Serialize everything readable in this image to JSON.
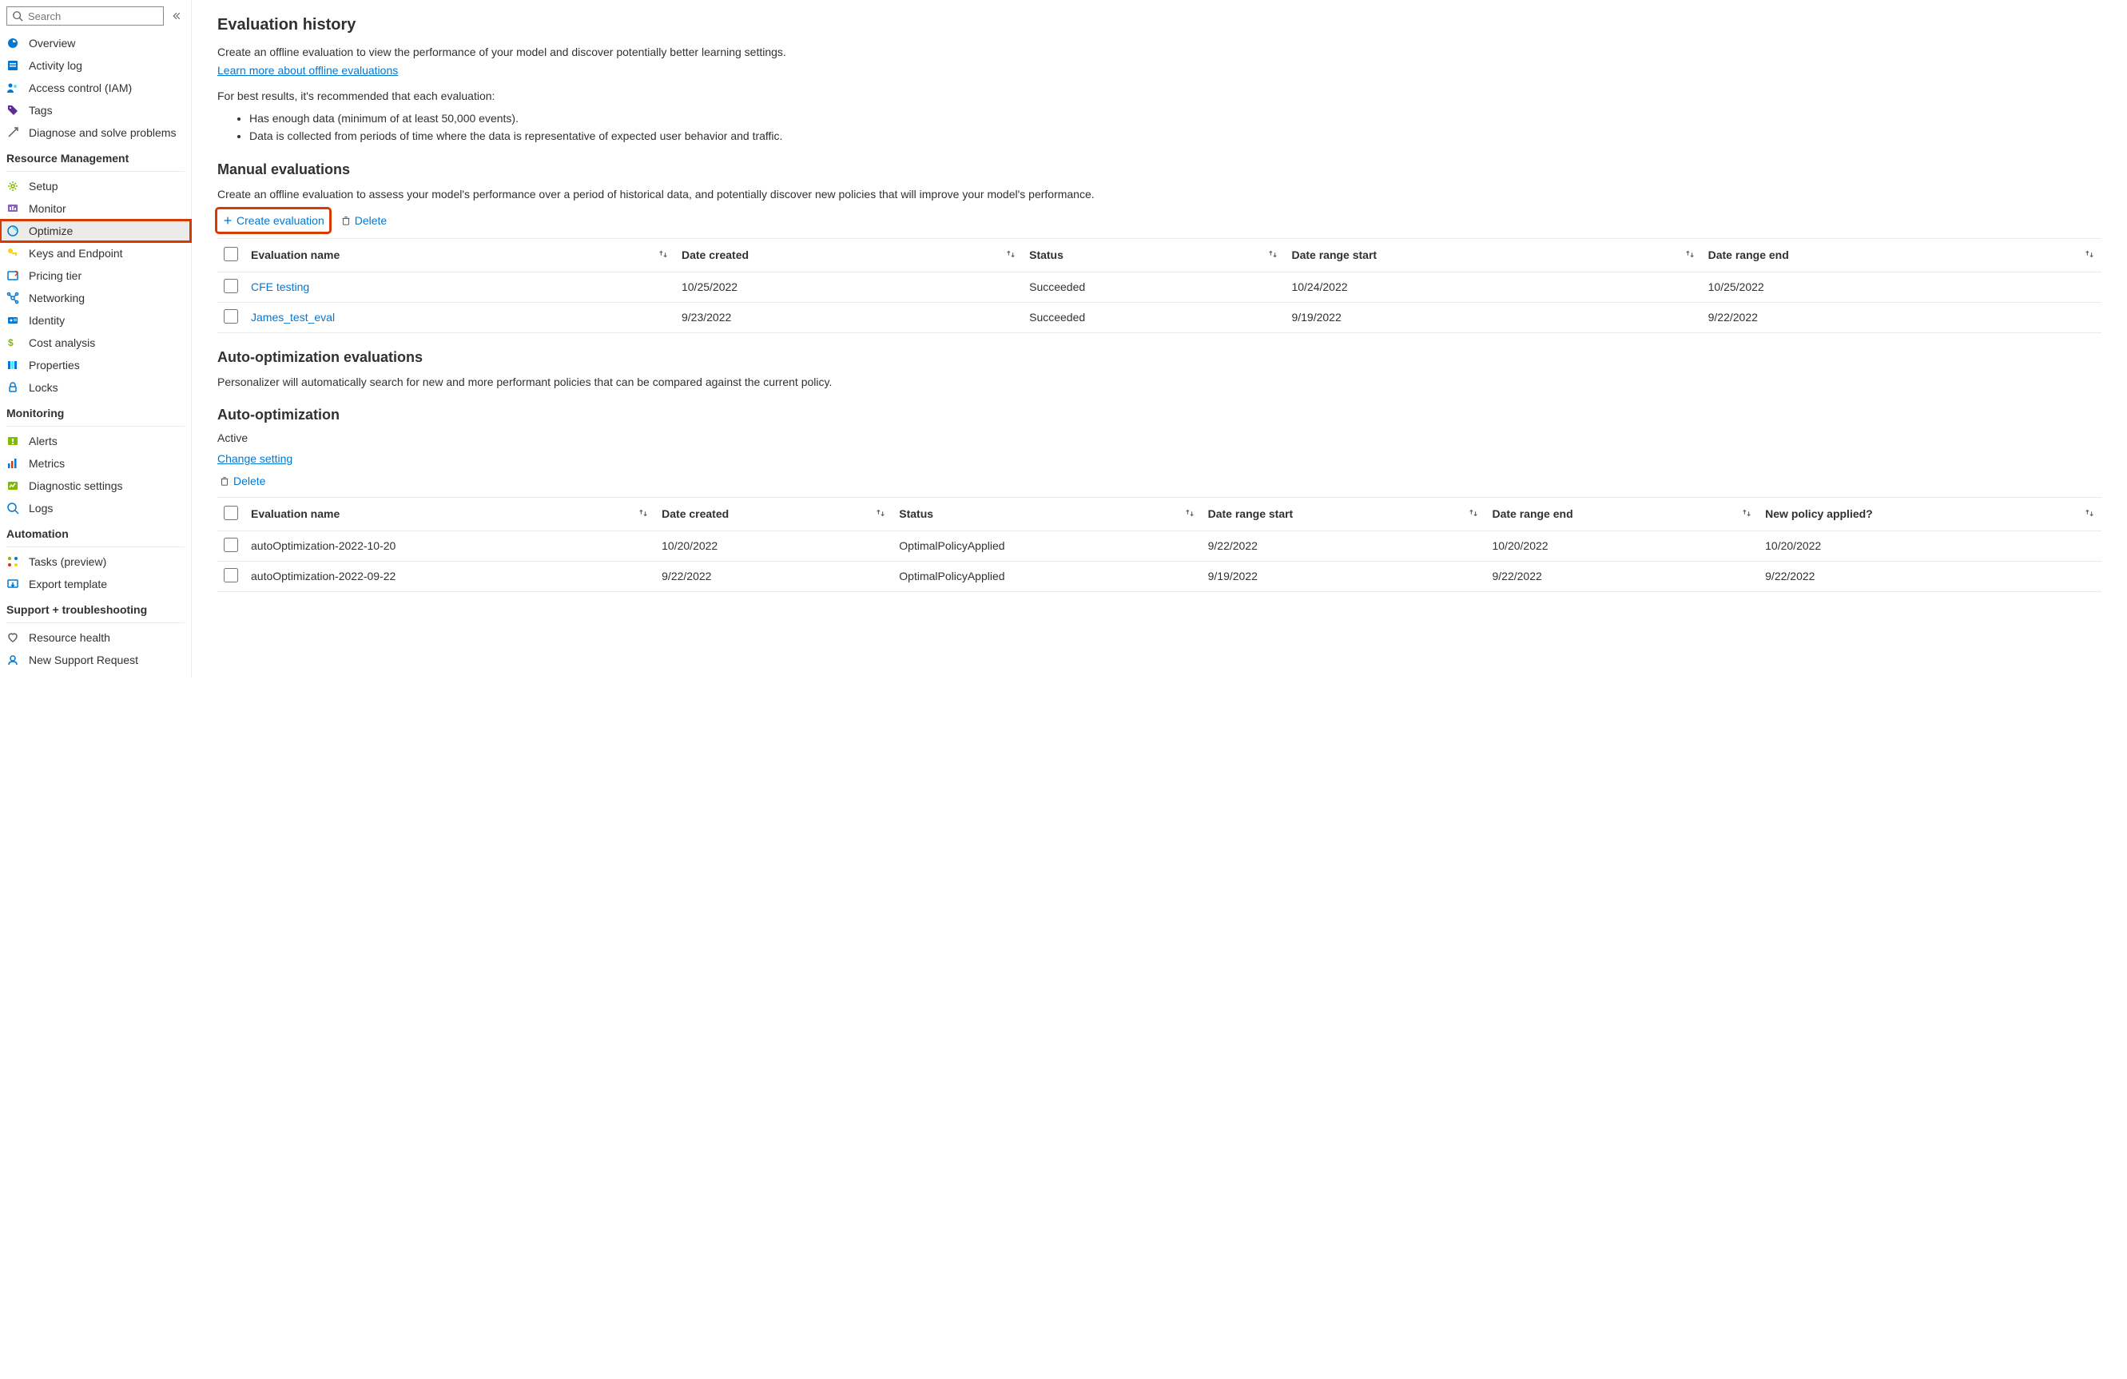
{
  "search": {
    "placeholder": "Search"
  },
  "sidebar": {
    "top": [
      {
        "label": "Overview"
      },
      {
        "label": "Activity log"
      },
      {
        "label": "Access control (IAM)"
      },
      {
        "label": "Tags"
      },
      {
        "label": "Diagnose and solve problems"
      }
    ],
    "sections": [
      {
        "header": "Resource Management",
        "items": [
          {
            "label": "Setup"
          },
          {
            "label": "Monitor"
          },
          {
            "label": "Optimize",
            "selected": true
          },
          {
            "label": "Keys and Endpoint"
          },
          {
            "label": "Pricing tier"
          },
          {
            "label": "Networking"
          },
          {
            "label": "Identity"
          },
          {
            "label": "Cost analysis"
          },
          {
            "label": "Properties"
          },
          {
            "label": "Locks"
          }
        ]
      },
      {
        "header": "Monitoring",
        "items": [
          {
            "label": "Alerts"
          },
          {
            "label": "Metrics"
          },
          {
            "label": "Diagnostic settings"
          },
          {
            "label": "Logs"
          }
        ]
      },
      {
        "header": "Automation",
        "items": [
          {
            "label": "Tasks (preview)"
          },
          {
            "label": "Export template"
          }
        ]
      },
      {
        "header": "Support + troubleshooting",
        "items": [
          {
            "label": "Resource health"
          },
          {
            "label": "New Support Request"
          }
        ]
      }
    ]
  },
  "page": {
    "title": "Evaluation history",
    "intro": "Create an offline evaluation to view the performance of your model and discover potentially better learning settings.",
    "learn_more": "Learn more about offline evaluations",
    "rec_intro": "For best results, it's recommended that each evaluation:",
    "rec_items": [
      "Has enough data (minimum of at least 50,000 events).",
      "Data is collected from periods of time where the data is representative of expected user behavior and traffic."
    ],
    "manual": {
      "title": "Manual evaluations",
      "desc": "Create an offline evaluation to assess your model's performance over a period of historical data, and potentially discover new policies that will improve your model's performance.",
      "create_label": "Create evaluation",
      "delete_label": "Delete",
      "columns": [
        "Evaluation name",
        "Date created",
        "Status",
        "Date range start",
        "Date range end"
      ],
      "rows": [
        {
          "name": "CFE testing",
          "created": "10/25/2022",
          "status": "Succeeded",
          "start": "10/24/2022",
          "end": "10/25/2022"
        },
        {
          "name": "James_test_eval",
          "created": "9/23/2022",
          "status": "Succeeded",
          "start": "9/19/2022",
          "end": "9/22/2022"
        }
      ]
    },
    "auto_eval": {
      "title": "Auto-optimization evaluations",
      "desc": "Personalizer will automatically search for new and more performant policies that can be compared against the current policy."
    },
    "auto_opt": {
      "title": "Auto-optimization",
      "status": "Active",
      "change_label": "Change setting",
      "delete_label": "Delete",
      "columns": [
        "Evaluation name",
        "Date created",
        "Status",
        "Date range start",
        "Date range end",
        "New policy applied?"
      ],
      "rows": [
        {
          "name": "autoOptimization-2022-10-20",
          "created": "10/20/2022",
          "status": "OptimalPolicyApplied",
          "start": "9/22/2022",
          "end": "10/20/2022",
          "applied": "10/20/2022"
        },
        {
          "name": "autoOptimization-2022-09-22",
          "created": "9/22/2022",
          "status": "OptimalPolicyApplied",
          "start": "9/19/2022",
          "end": "9/22/2022",
          "applied": "9/22/2022"
        }
      ]
    }
  }
}
